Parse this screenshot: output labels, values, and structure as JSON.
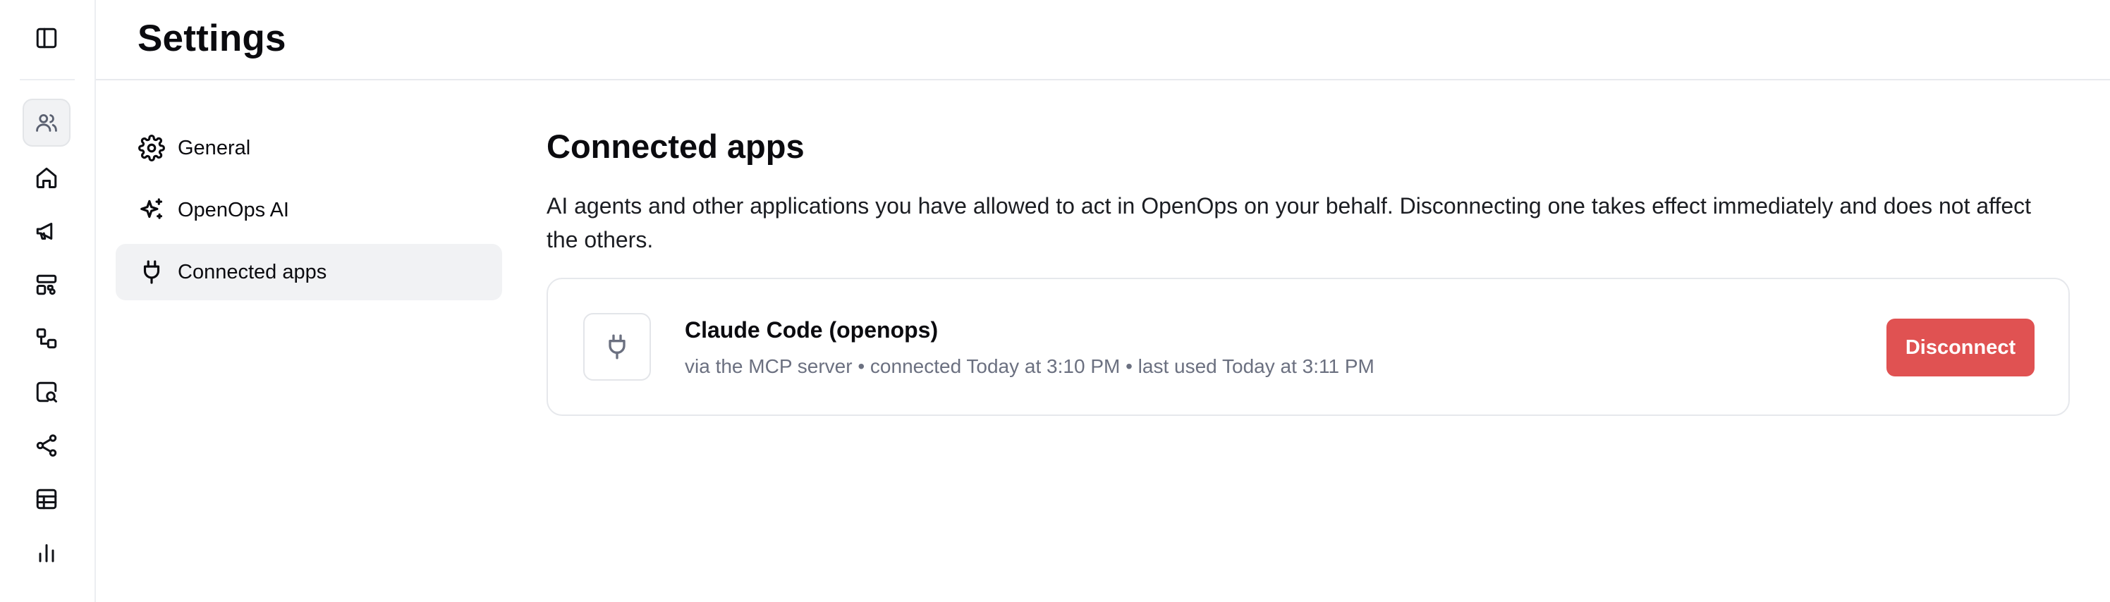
{
  "header": {
    "title": "Settings"
  },
  "rail": {
    "items": [
      {
        "icon": "users-icon",
        "active": true
      },
      {
        "icon": "home-icon",
        "active": false
      },
      {
        "icon": "megaphone-icon",
        "active": false
      },
      {
        "icon": "layout-icon",
        "active": false
      },
      {
        "icon": "workflow-icon",
        "active": false
      },
      {
        "icon": "search-file-icon",
        "active": false
      },
      {
        "icon": "share-icon",
        "active": false
      },
      {
        "icon": "table-icon",
        "active": false
      },
      {
        "icon": "bar-chart-icon",
        "active": false
      }
    ]
  },
  "subnav": {
    "items": [
      {
        "label": "General",
        "icon": "gear-icon",
        "active": false
      },
      {
        "label": "OpenOps AI",
        "icon": "sparkles-icon",
        "active": false
      },
      {
        "label": "Connected apps",
        "icon": "plug-icon",
        "active": true
      }
    ]
  },
  "main": {
    "title": "Connected apps",
    "description": "AI agents and other applications you have allowed to act in OpenOps on your behalf. Disconnecting one takes effect immediately and does not affect the others.",
    "apps": [
      {
        "name": "Claude Code (openops)",
        "meta": "via the MCP server • connected Today at 3:10 PM • last used Today at 3:11 PM",
        "icon": "plug-icon",
        "action_label": "Disconnect"
      }
    ]
  },
  "colors": {
    "danger": "#e05252",
    "muted_text": "#6b7080",
    "active_bg": "#f1f2f4",
    "border": "#e6e8ec"
  }
}
